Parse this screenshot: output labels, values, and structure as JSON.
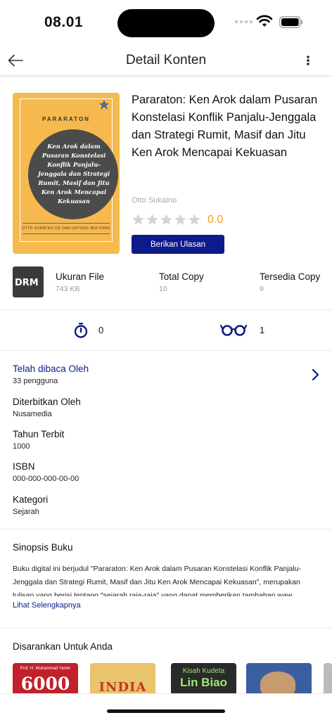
{
  "status_bar": {
    "time": "08.01"
  },
  "app_bar": {
    "title": "Detail Konten"
  },
  "book": {
    "cover": {
      "publisher_label": "PARARATON",
      "title_lines": [
        "Ken Arok dalam",
        "Pusaran Konstelasi",
        "Konflik Panjalu-",
        "Jenggala dan Strategi",
        "Rumit, Masif dan Jitu",
        "Ken Arok Mencapai",
        "Kekuasan"
      ],
      "authors": "OTTO SUKATNO CR DAN UNTUNG MULYONO"
    },
    "title": "Pararaton: Ken Arok dalam Pusaran Konstelasi Konflik Panjalu-Jenggala dan Strategi Rumit, Masif dan Jitu Ken Arok Mencapai Kekuasan",
    "author": "Otto Sukatno",
    "rating": "0.0",
    "rating_stars": 0,
    "review_button": "Berikan Ulasan"
  },
  "file_info": {
    "drm_label": "DRM",
    "size_label": "Ukuran File",
    "size_value": "743 KB",
    "total_label": "Total Copy",
    "total_value": "10",
    "available_label": "Tersedia Copy",
    "available_value": "9"
  },
  "stats": {
    "timer_count": "0",
    "readers_count": "1"
  },
  "details": {
    "read_by_label": "Telah dibaca Oleh",
    "read_by_value": "33 pengguna",
    "publisher_label": "Diterbitkan Oleh",
    "publisher_value": "Nusamedia",
    "year_label": "Tahun Terbit",
    "year_value": "1000",
    "isbn_label": "ISBN",
    "isbn_value": "000-000-000-00-00",
    "category_label": "Kategori",
    "category_value": "Sejarah"
  },
  "synopsis": {
    "title": "Sinopsis Buku",
    "body": "Buku digital ini berjudul \"Pararaton: Ken Arok dalam Pusaran Konstelasi Konflik Panjalu-Jenggala dan Strategi Rumit, Masif dan Jitu Ken Arok Mencapai Kekuasan\", merupakan tulisan yang berisi tentang \"sejarah raja-raja\" yang dapat memberikan tambahan waw...",
    "more_link": "Lihat Selengkapnya"
  },
  "recommendations": {
    "title": "Disarankan Untuk Anda",
    "items": [
      {
        "text": "6000",
        "subtext": "Prof. H. Muhammad Yamin",
        "color": "#c0212a"
      },
      {
        "text": "INDIA",
        "subtext": "",
        "color": "#e9c46a"
      },
      {
        "text": "Lin Biao",
        "subtext": "Kisah Kudeta",
        "color": "#2a2a2a"
      },
      {
        "text": "",
        "subtext": "",
        "color": "#3a5fa0"
      }
    ]
  },
  "colors": {
    "accent": "#0d1a8a",
    "rating": "#f0a020",
    "cover": "#f6b94e"
  }
}
